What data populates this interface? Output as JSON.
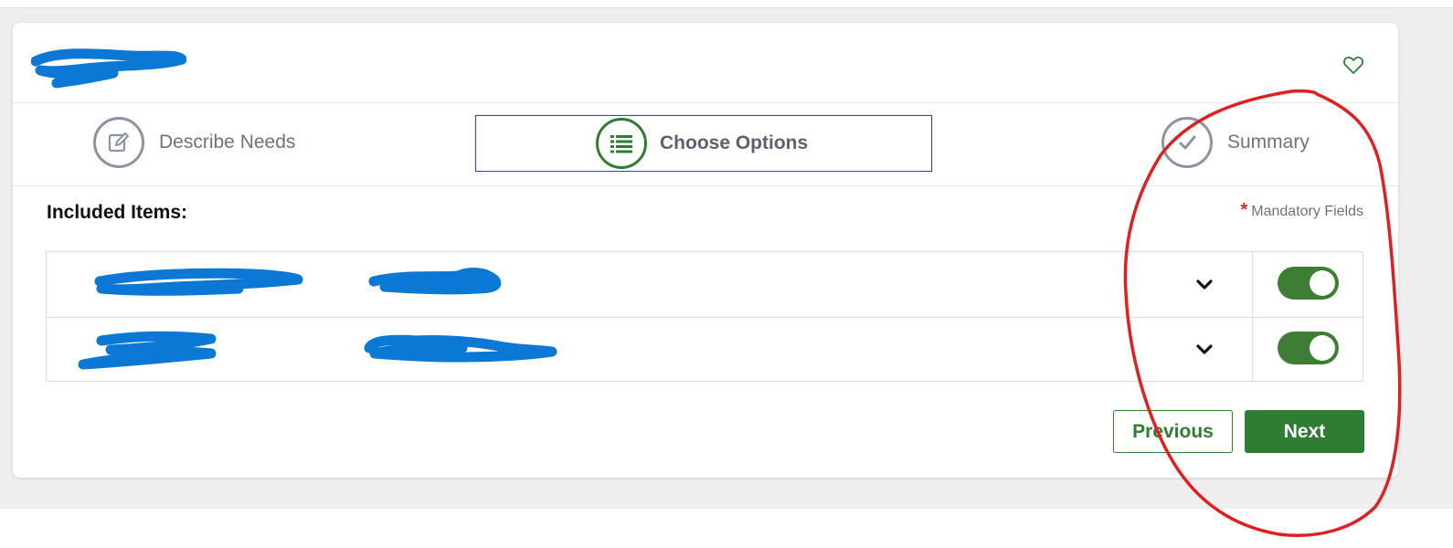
{
  "header": {
    "title_redacted": true,
    "favorite_icon": "heart-outline-icon"
  },
  "steps": [
    {
      "label": "Describe Needs",
      "icon": "edit-icon",
      "state": "completed"
    },
    {
      "label": "Choose Options",
      "icon": "list-icon",
      "state": "active"
    },
    {
      "label": "Summary",
      "icon": "check-icon",
      "state": "upcoming"
    }
  ],
  "content": {
    "included_items_label": "Included Items:",
    "mandatory_star": "*",
    "mandatory_label": "Mandatory Fields",
    "items": [
      {
        "name_redacted": true,
        "detail_redacted": true,
        "expand_icon": "chevron-down-icon",
        "enabled": true
      },
      {
        "name_redacted": true,
        "detail_redacted": true,
        "expand_icon": "chevron-down-icon",
        "enabled": true
      }
    ]
  },
  "buttons": {
    "previous_label": "Previous",
    "next_label": "Next"
  },
  "colors": {
    "primary_green": "#2e7d32",
    "toggle_green": "#3d7d34",
    "active_step_border": "#3f3fe0",
    "redaction_blue": "#0a78d4",
    "annotation_red": "#e02020",
    "mandatory_star": "#d32f2f"
  }
}
